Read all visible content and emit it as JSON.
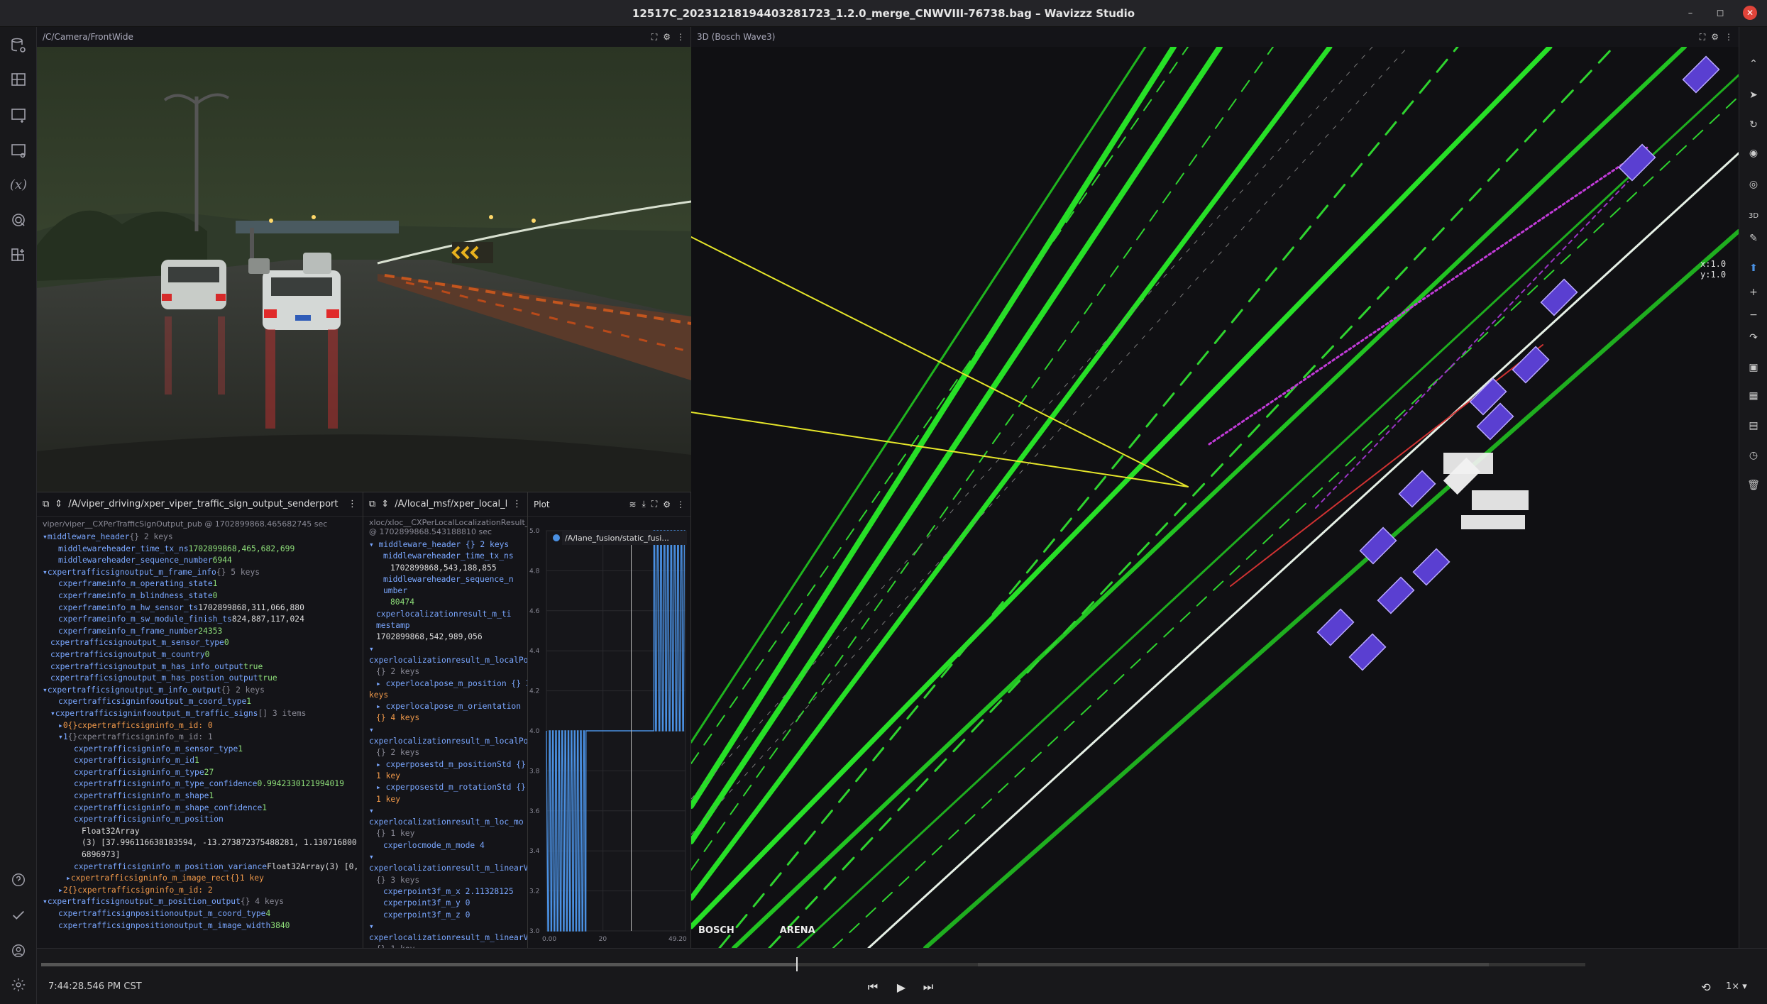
{
  "window": {
    "title": "12517C_20231218194403281723_1.2.0_merge_CNWVIII-76738.bag – Wavizzz Studio",
    "controls": [
      "–",
      "◻",
      "✕"
    ]
  },
  "left_rail": {
    "icons": [
      "database-gear-icon",
      "layout-grid-icon",
      "panel-add-icon",
      "panel-settings-icon",
      "variables-icon",
      "extensions-icon",
      "add-module-icon",
      "help-icon",
      "check-icon",
      "user-icon",
      "settings-icon"
    ],
    "variables_glyph": "(x)"
  },
  "camera_panel": {
    "topic": "/C/Camera/FrontWide"
  },
  "message_panel_1": {
    "topic": "/A/viper_driving/xper_viper_traffic_sign_output_senderport",
    "subtitle": "viper/viper__CXPerTrafficSignOutput_pub @ 1702899868.465682745 sec",
    "rows": [
      {
        "indent": 0,
        "arrow": "▾",
        "key": "middleware_header",
        "type": "{} 2 keys",
        "value": "",
        "kind": "obj"
      },
      {
        "indent": 2,
        "arrow": "",
        "key": "middlewareheader_time_tx_ns",
        "type": "",
        "value": "1702899868,465,682,699",
        "kind": "num"
      },
      {
        "indent": 2,
        "arrow": "",
        "key": "middlewareheader_sequence_number",
        "type": "",
        "value": "6944",
        "kind": "num"
      },
      {
        "indent": 0,
        "arrow": "▾",
        "key": "cxpertrafficsignoutput_m_frame_info",
        "type": "{} 5 keys",
        "value": "",
        "kind": "obj"
      },
      {
        "indent": 2,
        "arrow": "",
        "key": "cxperframeinfo_m_operating_state",
        "type": "",
        "value": "1",
        "kind": "num"
      },
      {
        "indent": 2,
        "arrow": "",
        "key": "cxperframeinfo_m_blindness_state",
        "type": "",
        "value": "0",
        "kind": "num"
      },
      {
        "indent": 2,
        "arrow": "",
        "key": "cxperframeinfo_m_hw_sensor_ts",
        "type": "",
        "value": "1702899868,311,066,880",
        "kind": "wht"
      },
      {
        "indent": 2,
        "arrow": "",
        "key": "cxperframeinfo_m_sw_module_finish_ts",
        "type": "",
        "value": "824,887,117,024",
        "kind": "wht"
      },
      {
        "indent": 2,
        "arrow": "",
        "key": "cxperframeinfo_m_frame_number",
        "type": "",
        "value": "24353",
        "kind": "num"
      },
      {
        "indent": 1,
        "arrow": "",
        "key": "cxpertrafficsignoutput_m_sensor_type",
        "type": "",
        "value": "0",
        "kind": "num"
      },
      {
        "indent": 1,
        "arrow": "",
        "key": "cxpertrafficsignoutput_m_country",
        "type": "",
        "value": "0",
        "kind": "num"
      },
      {
        "indent": 1,
        "arrow": "",
        "key": "cxpertrafficsignoutput_m_has_info_output",
        "type": "",
        "value": "true",
        "kind": "num"
      },
      {
        "indent": 1,
        "arrow": "",
        "key": "cxpertrafficsignoutput_m_has_postion_output",
        "type": "",
        "value": "true",
        "kind": "num"
      },
      {
        "indent": 0,
        "arrow": "▾",
        "key": "cxpertrafficsignoutput_m_info_output",
        "type": "{} 2 keys",
        "value": "",
        "kind": "obj"
      },
      {
        "indent": 2,
        "arrow": "",
        "key": "cxpertrafficsigninfooutput_m_coord_type",
        "type": "",
        "value": "1",
        "kind": "num"
      },
      {
        "indent": 1,
        "arrow": "▾",
        "key": "cxpertrafficsigninfooutput_m_traffic_signs",
        "type": "[] 3 items",
        "value": "",
        "kind": "obj"
      },
      {
        "indent": 2,
        "arrow": "▸",
        "key": "0",
        "type": "{}",
        "value": "cxpertrafficsigninfo_m_id: 0",
        "kind": "orange"
      },
      {
        "indent": 2,
        "arrow": "▾",
        "key": "1",
        "type": "{}",
        "value": "cxpertrafficsigninfo_m_id: 1",
        "kind": "gray"
      },
      {
        "indent": 4,
        "arrow": "",
        "key": "cxpertrafficsigninfo_m_sensor_type",
        "type": "",
        "value": "1",
        "kind": "num"
      },
      {
        "indent": 4,
        "arrow": "",
        "key": "cxpertrafficsigninfo_m_id",
        "type": "",
        "value": "1",
        "kind": "num"
      },
      {
        "indent": 4,
        "arrow": "",
        "key": "cxpertrafficsigninfo_m_type",
        "type": "",
        "value": "27",
        "kind": "num"
      },
      {
        "indent": 4,
        "arrow": "",
        "key": "cxpertrafficsigninfo_m_type_confidence",
        "type": "",
        "value": "0.9942330121994019",
        "kind": "num"
      },
      {
        "indent": 4,
        "arrow": "",
        "key": "cxpertrafficsigninfo_m_shape",
        "type": "",
        "value": "1",
        "kind": "num"
      },
      {
        "indent": 4,
        "arrow": "",
        "key": "cxpertrafficsigninfo_m_shape_confidence",
        "type": "",
        "value": "1",
        "kind": "num"
      },
      {
        "indent": 4,
        "arrow": "",
        "key": "cxpertrafficsigninfo_m_position",
        "type": "",
        "value": "",
        "kind": "num"
      },
      {
        "indent": 5,
        "arrow": "",
        "key": "",
        "type": "",
        "value": "Float32Array",
        "kind": "wht"
      },
      {
        "indent": 5,
        "arrow": "",
        "key": "",
        "type": "",
        "value": "(3) [37.99611663818359​4, -13.273872375488281, 1.130716800",
        "kind": "wht"
      },
      {
        "indent": 5,
        "arrow": "",
        "key": "",
        "type": "",
        "value": "6896973]",
        "kind": "wht"
      },
      {
        "indent": 4,
        "arrow": "",
        "key": "cxpertrafficsigninfo_m_position_variance",
        "type": "",
        "value": "Float32Array(3) [0, 0, 0]",
        "kind": "wht"
      },
      {
        "indent": 3,
        "arrow": "▸",
        "key": "cxpertrafficsigninfo_m_image_rect",
        "type": "{}",
        "value": "1 key",
        "kind": "orange"
      },
      {
        "indent": 2,
        "arrow": "▸",
        "key": "2",
        "type": "{}",
        "value": "cxpertrafficsigninfo_m_id: 2",
        "kind": "orange"
      },
      {
        "indent": 0,
        "arrow": "▾",
        "key": "cxpertrafficsignoutput_m_position_output",
        "type": "{} 4 keys",
        "value": "",
        "kind": "obj"
      },
      {
        "indent": 2,
        "arrow": "",
        "key": "cxpertrafficsignpositionoutput_m_coord_type",
        "type": "",
        "value": "4",
        "kind": "num"
      },
      {
        "indent": 2,
        "arrow": "",
        "key": "cxpertrafficsignpositionoutput_m_image_width",
        "type": "",
        "value": "3840",
        "kind": "num"
      }
    ]
  },
  "message_panel_2": {
    "topic": "/A/local_msf/xper_local_lo",
    "subtitle_lines": [
      "xloc/xloc__CXPerLocalLocalizationResult_pub",
      "@ 1702899868.543188810 sec"
    ],
    "lines": [
      {
        "cls": "k",
        "ind": 0,
        "t": "▾  middleware_header   {} 2 keys"
      },
      {
        "cls": "k",
        "ind": 2,
        "t": "middlewareheader_time_tx_ns"
      },
      {
        "cls": "wht",
        "ind": 3,
        "t": "1702899868,543,188,855"
      },
      {
        "cls": "k",
        "ind": 2,
        "t": "middlewareheader_sequence_n"
      },
      {
        "cls": "k",
        "ind": 2,
        "t": "umber"
      },
      {
        "cls": "num",
        "ind": 3,
        "t": "80474"
      },
      {
        "cls": "k",
        "ind": 1,
        "t": "cxperlocalizationresult_m_ti"
      },
      {
        "cls": "k",
        "ind": 1,
        "t": "mestamp"
      },
      {
        "cls": "wht",
        "ind": 1,
        "t": "1702899868,542,989,056"
      },
      {
        "cls": "k",
        "ind": 0,
        "t": "▾"
      },
      {
        "cls": "k",
        "ind": 0,
        "t": "cxperlocalizationresult_m_localPo"
      },
      {
        "cls": "dim",
        "ind": 1,
        "t": "{} 2 keys"
      },
      {
        "cls": "k",
        "ind": 1,
        "t": "▸ cxperlocalpose_m_position   {} 3"
      },
      {
        "cls": "orange",
        "ind": 0,
        "t": "keys"
      },
      {
        "cls": "k",
        "ind": 1,
        "t": "▸ cxperlocalpose_m_orientation"
      },
      {
        "cls": "orange",
        "ind": 1,
        "t": "{} 4 keys"
      },
      {
        "cls": "k",
        "ind": 0,
        "t": "▾"
      },
      {
        "cls": "k",
        "ind": 0,
        "t": "cxperlocalizationresult_m_localPo"
      },
      {
        "cls": "dim",
        "ind": 1,
        "t": "{} 2 keys"
      },
      {
        "cls": "k",
        "ind": 1,
        "t": "▸ cxperposestd_m_positionStd   {}"
      },
      {
        "cls": "orange",
        "ind": 1,
        "t": "1 key"
      },
      {
        "cls": "k",
        "ind": 1,
        "t": "▸ cxperposestd_m_rotationStd   {}"
      },
      {
        "cls": "orange",
        "ind": 1,
        "t": "1 key"
      },
      {
        "cls": "k",
        "ind": 0,
        "t": "▾"
      },
      {
        "cls": "k",
        "ind": 0,
        "t": "cxperlocalizationresult_m_loc_mo"
      },
      {
        "cls": "dim",
        "ind": 1,
        "t": "{} 1 key"
      },
      {
        "cls": "k",
        "ind": 2,
        "t": "cxperlocmode_m_mode   4"
      },
      {
        "cls": "k",
        "ind": 0,
        "t": "▾"
      },
      {
        "cls": "k",
        "ind": 0,
        "t": "cxperlocalizationresult_m_linearVe"
      },
      {
        "cls": "dim",
        "ind": 1,
        "t": "{} 3 keys"
      },
      {
        "cls": "k",
        "ind": 2,
        "t": "cxperpoint3f_m_x   2.11328125"
      },
      {
        "cls": "k",
        "ind": 2,
        "t": "cxperpoint3f_m_y   0"
      },
      {
        "cls": "k",
        "ind": 2,
        "t": "cxperpoint3f_m_z   0"
      },
      {
        "cls": "k",
        "ind": 0,
        "t": "▾"
      },
      {
        "cls": "k",
        "ind": 0,
        "t": "cxperlocalizationresult_m_linearVe"
      },
      {
        "cls": "dim",
        "ind": 1,
        "t": "{} 1 key"
      }
    ]
  },
  "plot_panel": {
    "title": "Plot",
    "legend": "/A/lane_fusion/static_fusi...",
    "legend_color": "#4a90e2",
    "chart_data": {
      "type": "line",
      "series": [
        {
          "name": "/A/lane_fusion/static_fusi...",
          "color": "#4a90e2"
        }
      ],
      "y_ticks": [
        "5.0",
        "4.8",
        "4.6",
        "4.4",
        "4.2",
        "4.0",
        "3.8",
        "3.6",
        "3.4",
        "3.2",
        "3.0"
      ],
      "x_ticks": [
        "0.00",
        "20",
        "49.20"
      ],
      "ylim": [
        3.0,
        5.0
      ],
      "xlim": [
        0,
        49.2
      ]
    }
  },
  "view3d": {
    "title": "3D (Bosch Wave3)",
    "coords": [
      "x:1.0",
      "y:1.0"
    ],
    "logos": [
      "BOSCH",
      "ARENA"
    ]
  },
  "playback": {
    "time": "7:44:28.546 PM CST",
    "speed": "1×",
    "progress": 0.489
  },
  "colors": {
    "accent": "#4a90e2",
    "lane_green": "#2bdc2b",
    "object_purple": "#7b5cff",
    "close_red": "#e0443a"
  }
}
